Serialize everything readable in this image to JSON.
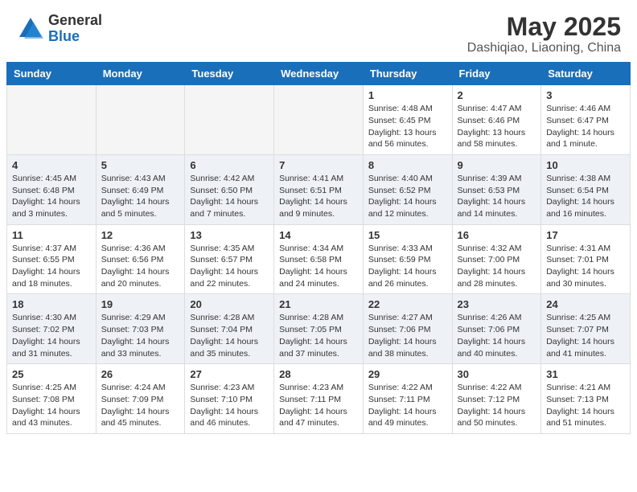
{
  "header": {
    "logo_general": "General",
    "logo_blue": "Blue",
    "month_title": "May 2025",
    "location": "Dashiqiao, Liaoning, China"
  },
  "weekdays": [
    "Sunday",
    "Monday",
    "Tuesday",
    "Wednesday",
    "Thursday",
    "Friday",
    "Saturday"
  ],
  "weeks": [
    [
      {
        "day": "",
        "empty": true
      },
      {
        "day": "",
        "empty": true
      },
      {
        "day": "",
        "empty": true
      },
      {
        "day": "",
        "empty": true
      },
      {
        "day": "1",
        "sunrise": "4:48 AM",
        "sunset": "6:45 PM",
        "daylight": "13 hours and 56 minutes."
      },
      {
        "day": "2",
        "sunrise": "4:47 AM",
        "sunset": "6:46 PM",
        "daylight": "13 hours and 58 minutes."
      },
      {
        "day": "3",
        "sunrise": "4:46 AM",
        "sunset": "6:47 PM",
        "daylight": "14 hours and 1 minute."
      }
    ],
    [
      {
        "day": "4",
        "sunrise": "4:45 AM",
        "sunset": "6:48 PM",
        "daylight": "14 hours and 3 minutes."
      },
      {
        "day": "5",
        "sunrise": "4:43 AM",
        "sunset": "6:49 PM",
        "daylight": "14 hours and 5 minutes."
      },
      {
        "day": "6",
        "sunrise": "4:42 AM",
        "sunset": "6:50 PM",
        "daylight": "14 hours and 7 minutes."
      },
      {
        "day": "7",
        "sunrise": "4:41 AM",
        "sunset": "6:51 PM",
        "daylight": "14 hours and 9 minutes."
      },
      {
        "day": "8",
        "sunrise": "4:40 AM",
        "sunset": "6:52 PM",
        "daylight": "14 hours and 12 minutes."
      },
      {
        "day": "9",
        "sunrise": "4:39 AM",
        "sunset": "6:53 PM",
        "daylight": "14 hours and 14 minutes."
      },
      {
        "day": "10",
        "sunrise": "4:38 AM",
        "sunset": "6:54 PM",
        "daylight": "14 hours and 16 minutes."
      }
    ],
    [
      {
        "day": "11",
        "sunrise": "4:37 AM",
        "sunset": "6:55 PM",
        "daylight": "14 hours and 18 minutes."
      },
      {
        "day": "12",
        "sunrise": "4:36 AM",
        "sunset": "6:56 PM",
        "daylight": "14 hours and 20 minutes."
      },
      {
        "day": "13",
        "sunrise": "4:35 AM",
        "sunset": "6:57 PM",
        "daylight": "14 hours and 22 minutes."
      },
      {
        "day": "14",
        "sunrise": "4:34 AM",
        "sunset": "6:58 PM",
        "daylight": "14 hours and 24 minutes."
      },
      {
        "day": "15",
        "sunrise": "4:33 AM",
        "sunset": "6:59 PM",
        "daylight": "14 hours and 26 minutes."
      },
      {
        "day": "16",
        "sunrise": "4:32 AM",
        "sunset": "7:00 PM",
        "daylight": "14 hours and 28 minutes."
      },
      {
        "day": "17",
        "sunrise": "4:31 AM",
        "sunset": "7:01 PM",
        "daylight": "14 hours and 30 minutes."
      }
    ],
    [
      {
        "day": "18",
        "sunrise": "4:30 AM",
        "sunset": "7:02 PM",
        "daylight": "14 hours and 31 minutes."
      },
      {
        "day": "19",
        "sunrise": "4:29 AM",
        "sunset": "7:03 PM",
        "daylight": "14 hours and 33 minutes."
      },
      {
        "day": "20",
        "sunrise": "4:28 AM",
        "sunset": "7:04 PM",
        "daylight": "14 hours and 35 minutes."
      },
      {
        "day": "21",
        "sunrise": "4:28 AM",
        "sunset": "7:05 PM",
        "daylight": "14 hours and 37 minutes."
      },
      {
        "day": "22",
        "sunrise": "4:27 AM",
        "sunset": "7:06 PM",
        "daylight": "14 hours and 38 minutes."
      },
      {
        "day": "23",
        "sunrise": "4:26 AM",
        "sunset": "7:06 PM",
        "daylight": "14 hours and 40 minutes."
      },
      {
        "day": "24",
        "sunrise": "4:25 AM",
        "sunset": "7:07 PM",
        "daylight": "14 hours and 41 minutes."
      }
    ],
    [
      {
        "day": "25",
        "sunrise": "4:25 AM",
        "sunset": "7:08 PM",
        "daylight": "14 hours and 43 minutes."
      },
      {
        "day": "26",
        "sunrise": "4:24 AM",
        "sunset": "7:09 PM",
        "daylight": "14 hours and 45 minutes."
      },
      {
        "day": "27",
        "sunrise": "4:23 AM",
        "sunset": "7:10 PM",
        "daylight": "14 hours and 46 minutes."
      },
      {
        "day": "28",
        "sunrise": "4:23 AM",
        "sunset": "7:11 PM",
        "daylight": "14 hours and 47 minutes."
      },
      {
        "day": "29",
        "sunrise": "4:22 AM",
        "sunset": "7:11 PM",
        "daylight": "14 hours and 49 minutes."
      },
      {
        "day": "30",
        "sunrise": "4:22 AM",
        "sunset": "7:12 PM",
        "daylight": "14 hours and 50 minutes."
      },
      {
        "day": "31",
        "sunrise": "4:21 AM",
        "sunset": "7:13 PM",
        "daylight": "14 hours and 51 minutes."
      }
    ]
  ]
}
